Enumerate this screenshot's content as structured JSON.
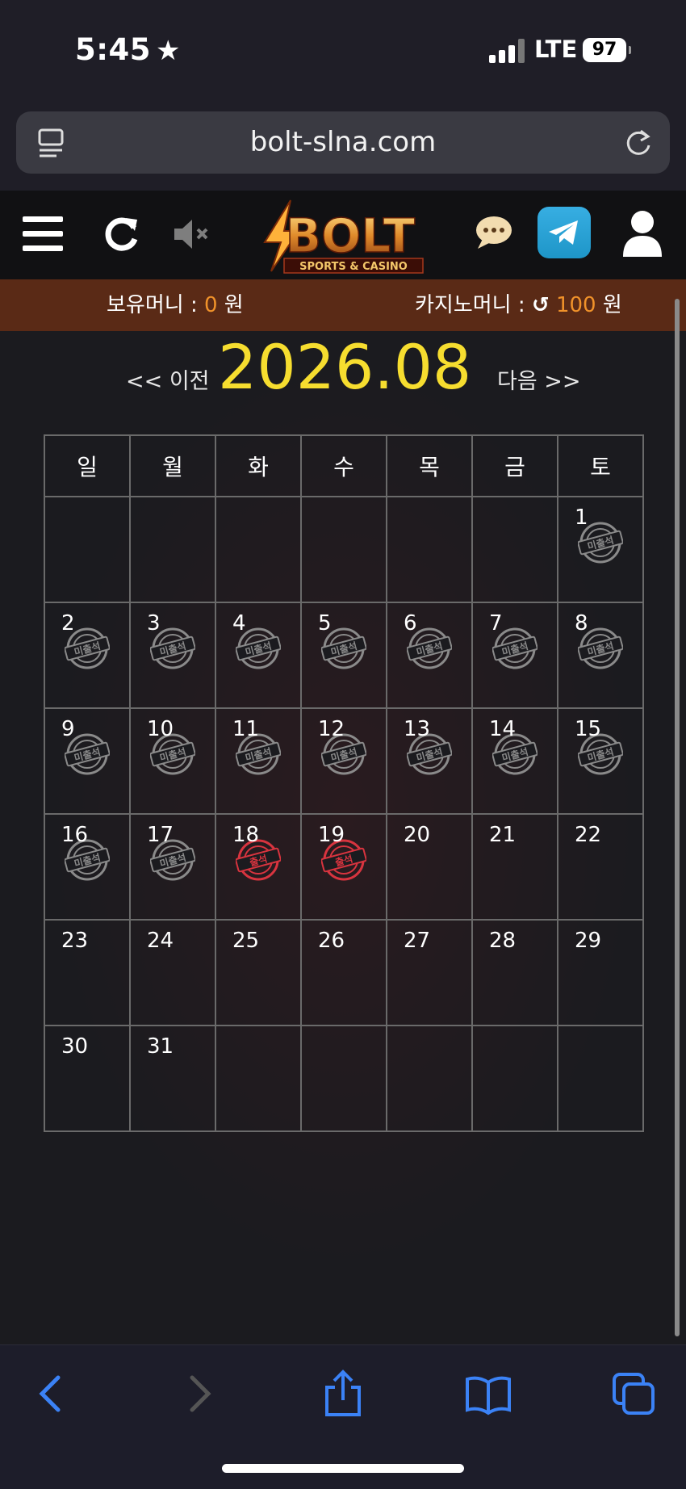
{
  "status_bar": {
    "time": "5:45",
    "network": "LTE",
    "battery": "97"
  },
  "browser": {
    "url": "bolt-slna.com"
  },
  "header": {
    "logo_text": "BOLT",
    "logo_sub": "SPORTS & CASINO"
  },
  "money": {
    "holding_label": "보유머니 : ",
    "holding_value": "0",
    "casino_label": "카지노머니 : ",
    "casino_value": "100",
    "unit": "원"
  },
  "calendar": {
    "prev_label": "<< 이전",
    "next_label": "다음 >>",
    "title": "2026.08",
    "weekdays": [
      "일",
      "월",
      "화",
      "수",
      "목",
      "금",
      "토"
    ],
    "weeks": [
      [
        "",
        "",
        "",
        "",
        "",
        "",
        "1"
      ],
      [
        "2",
        "3",
        "4",
        "5",
        "6",
        "7",
        "8"
      ],
      [
        "9",
        "10",
        "11",
        "12",
        "13",
        "14",
        "15"
      ],
      [
        "16",
        "17",
        "18",
        "19",
        "20",
        "21",
        "22"
      ],
      [
        "23",
        "24",
        "25",
        "26",
        "27",
        "28",
        "29"
      ],
      [
        "30",
        "31",
        "",
        "",
        "",
        "",
        ""
      ]
    ],
    "absent_stamp": "미출석",
    "present_stamp": "출석",
    "absent_days": [
      "1",
      "2",
      "3",
      "4",
      "5",
      "6",
      "7",
      "8",
      "9",
      "10",
      "11",
      "12",
      "13",
      "14",
      "15",
      "16",
      "17"
    ],
    "present_days": [
      "18",
      "19"
    ]
  },
  "colors": {
    "accent_yellow": "#f6dd2f",
    "money_orange": "#f0922a",
    "stamp_red": "#d8343f",
    "stamp_gray": "#8a8a8a"
  }
}
